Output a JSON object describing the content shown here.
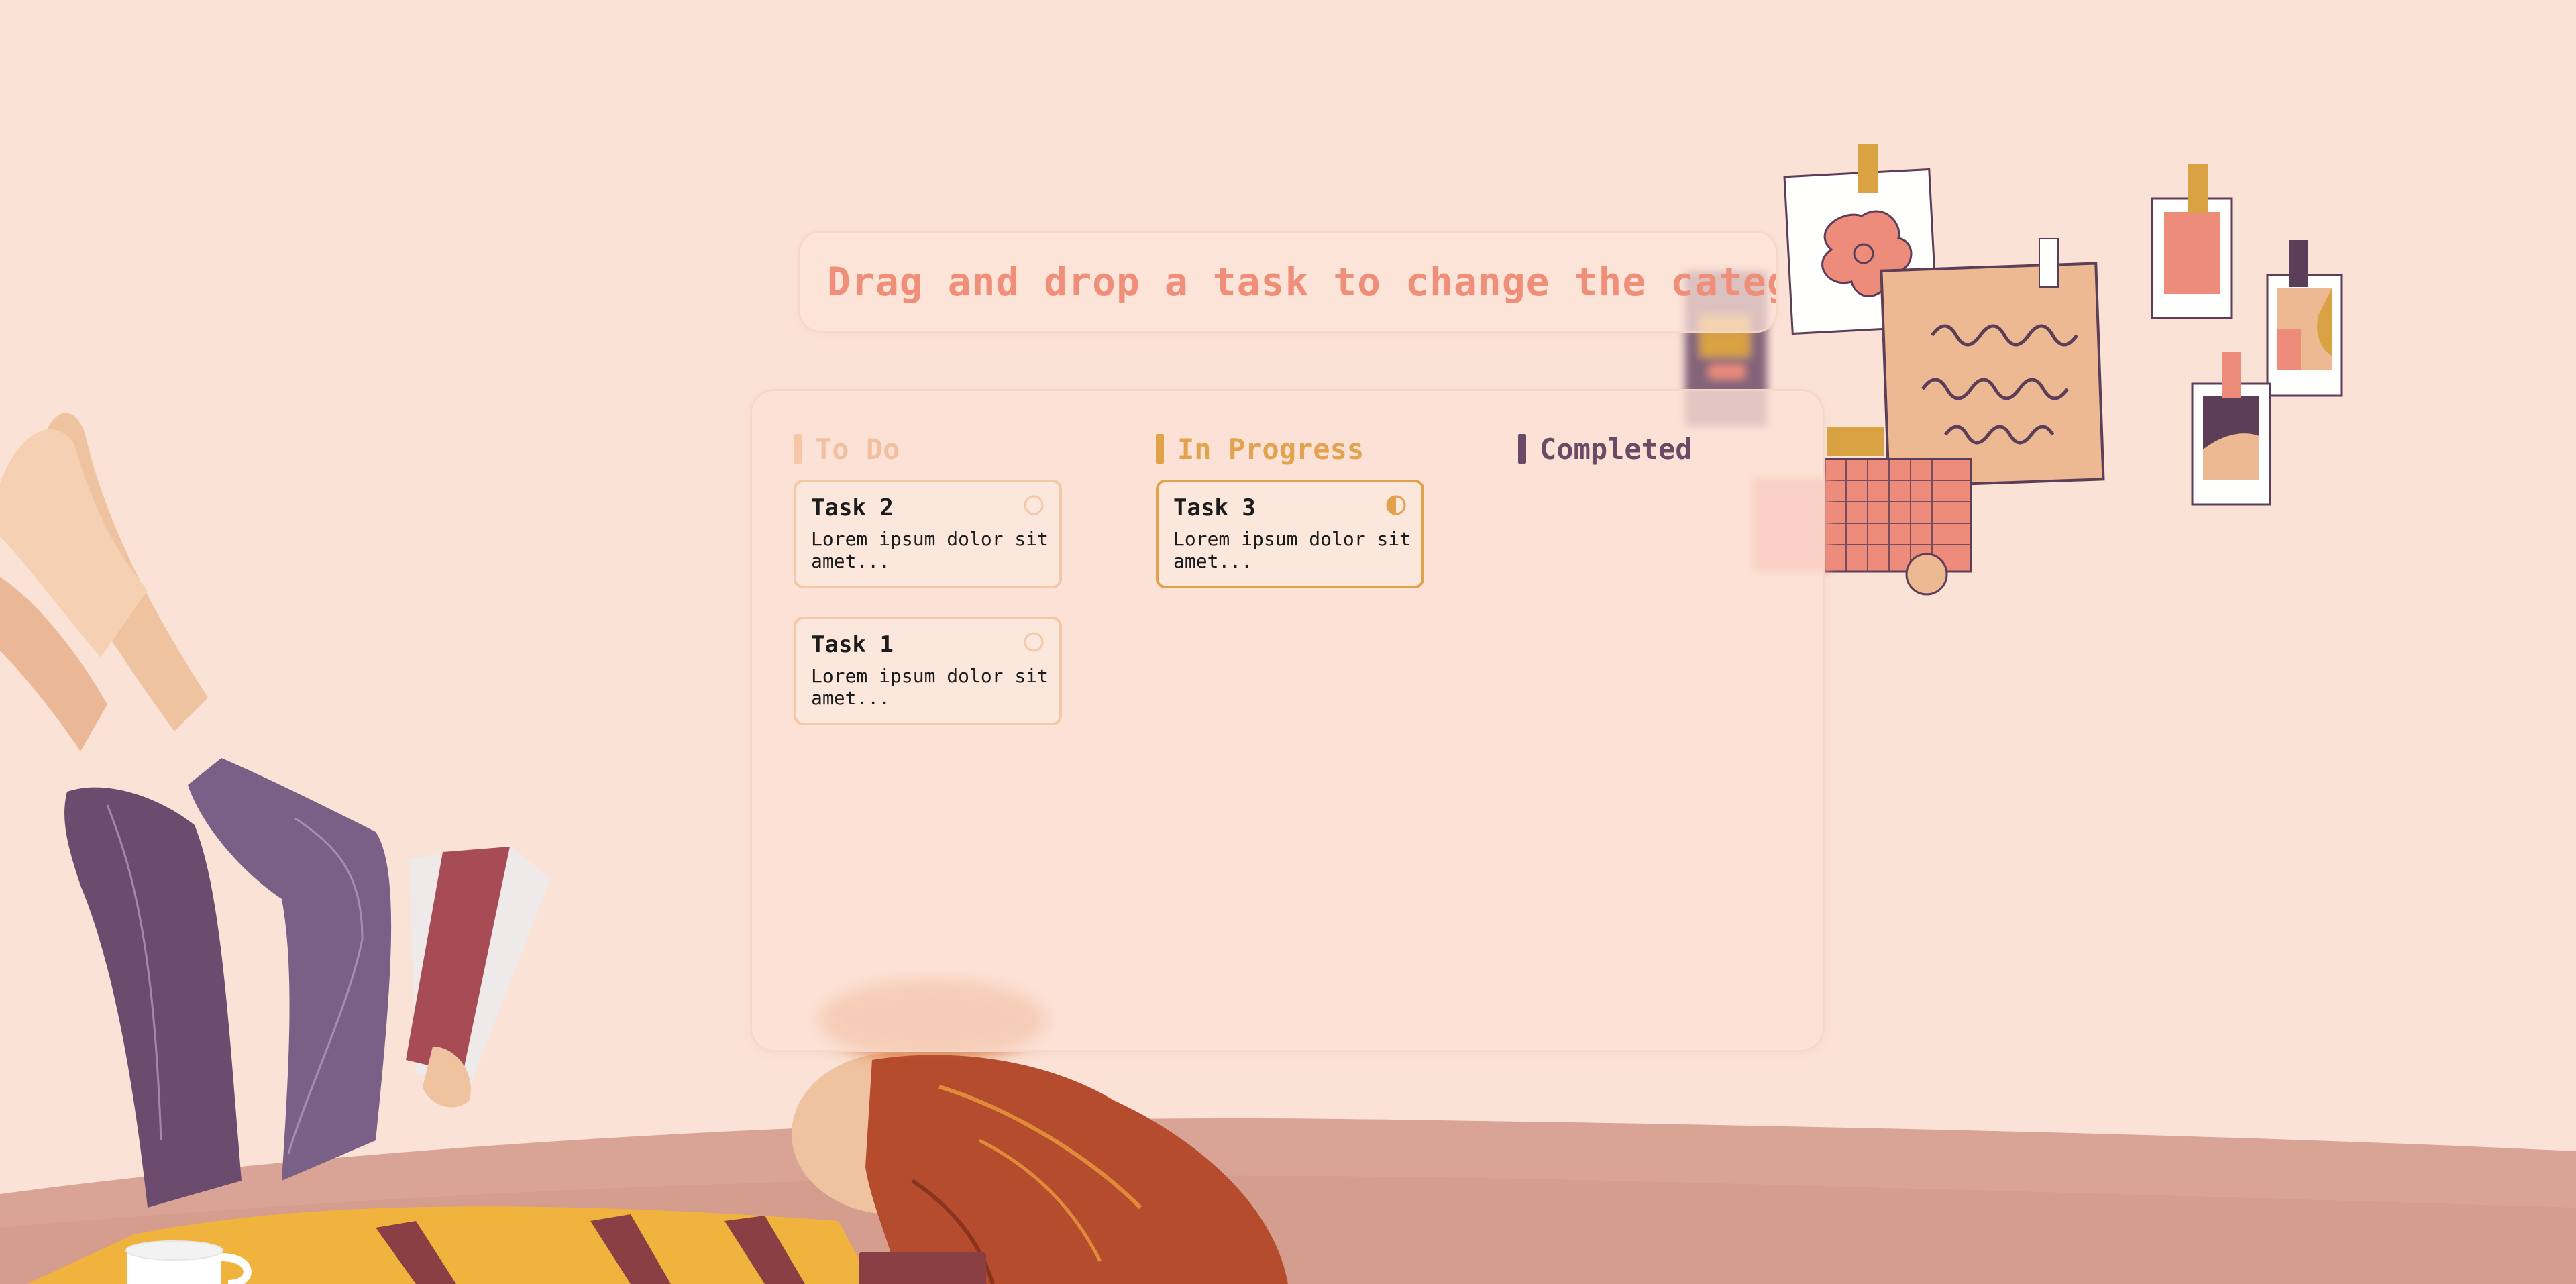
{
  "hint": {
    "text": "Drag and drop a task to change the category"
  },
  "columns": [
    {
      "title": "To Do",
      "color": "#f2c0a0",
      "tasks": [
        {
          "title": "Task 2",
          "description": "Lorem ipsum dolor sit amet...",
          "status_icon": "empty-circle-icon"
        },
        {
          "title": "Task 1",
          "description": "Lorem ipsum dolor sit amet...",
          "status_icon": "empty-circle-icon"
        }
      ]
    },
    {
      "title": "In Progress",
      "color": "#e3a24e",
      "tasks": [
        {
          "title": "Task 3",
          "description": "Lorem ipsum dolor sit amet...",
          "status_icon": "half-circle-icon"
        }
      ]
    },
    {
      "title": "Completed",
      "color": "#694b65",
      "tasks": []
    }
  ],
  "colors": {
    "background": "#fbe2d7",
    "accent_salmon": "#ef8f7a",
    "accent_orange": "#e3a24e",
    "accent_plum": "#694b65"
  }
}
